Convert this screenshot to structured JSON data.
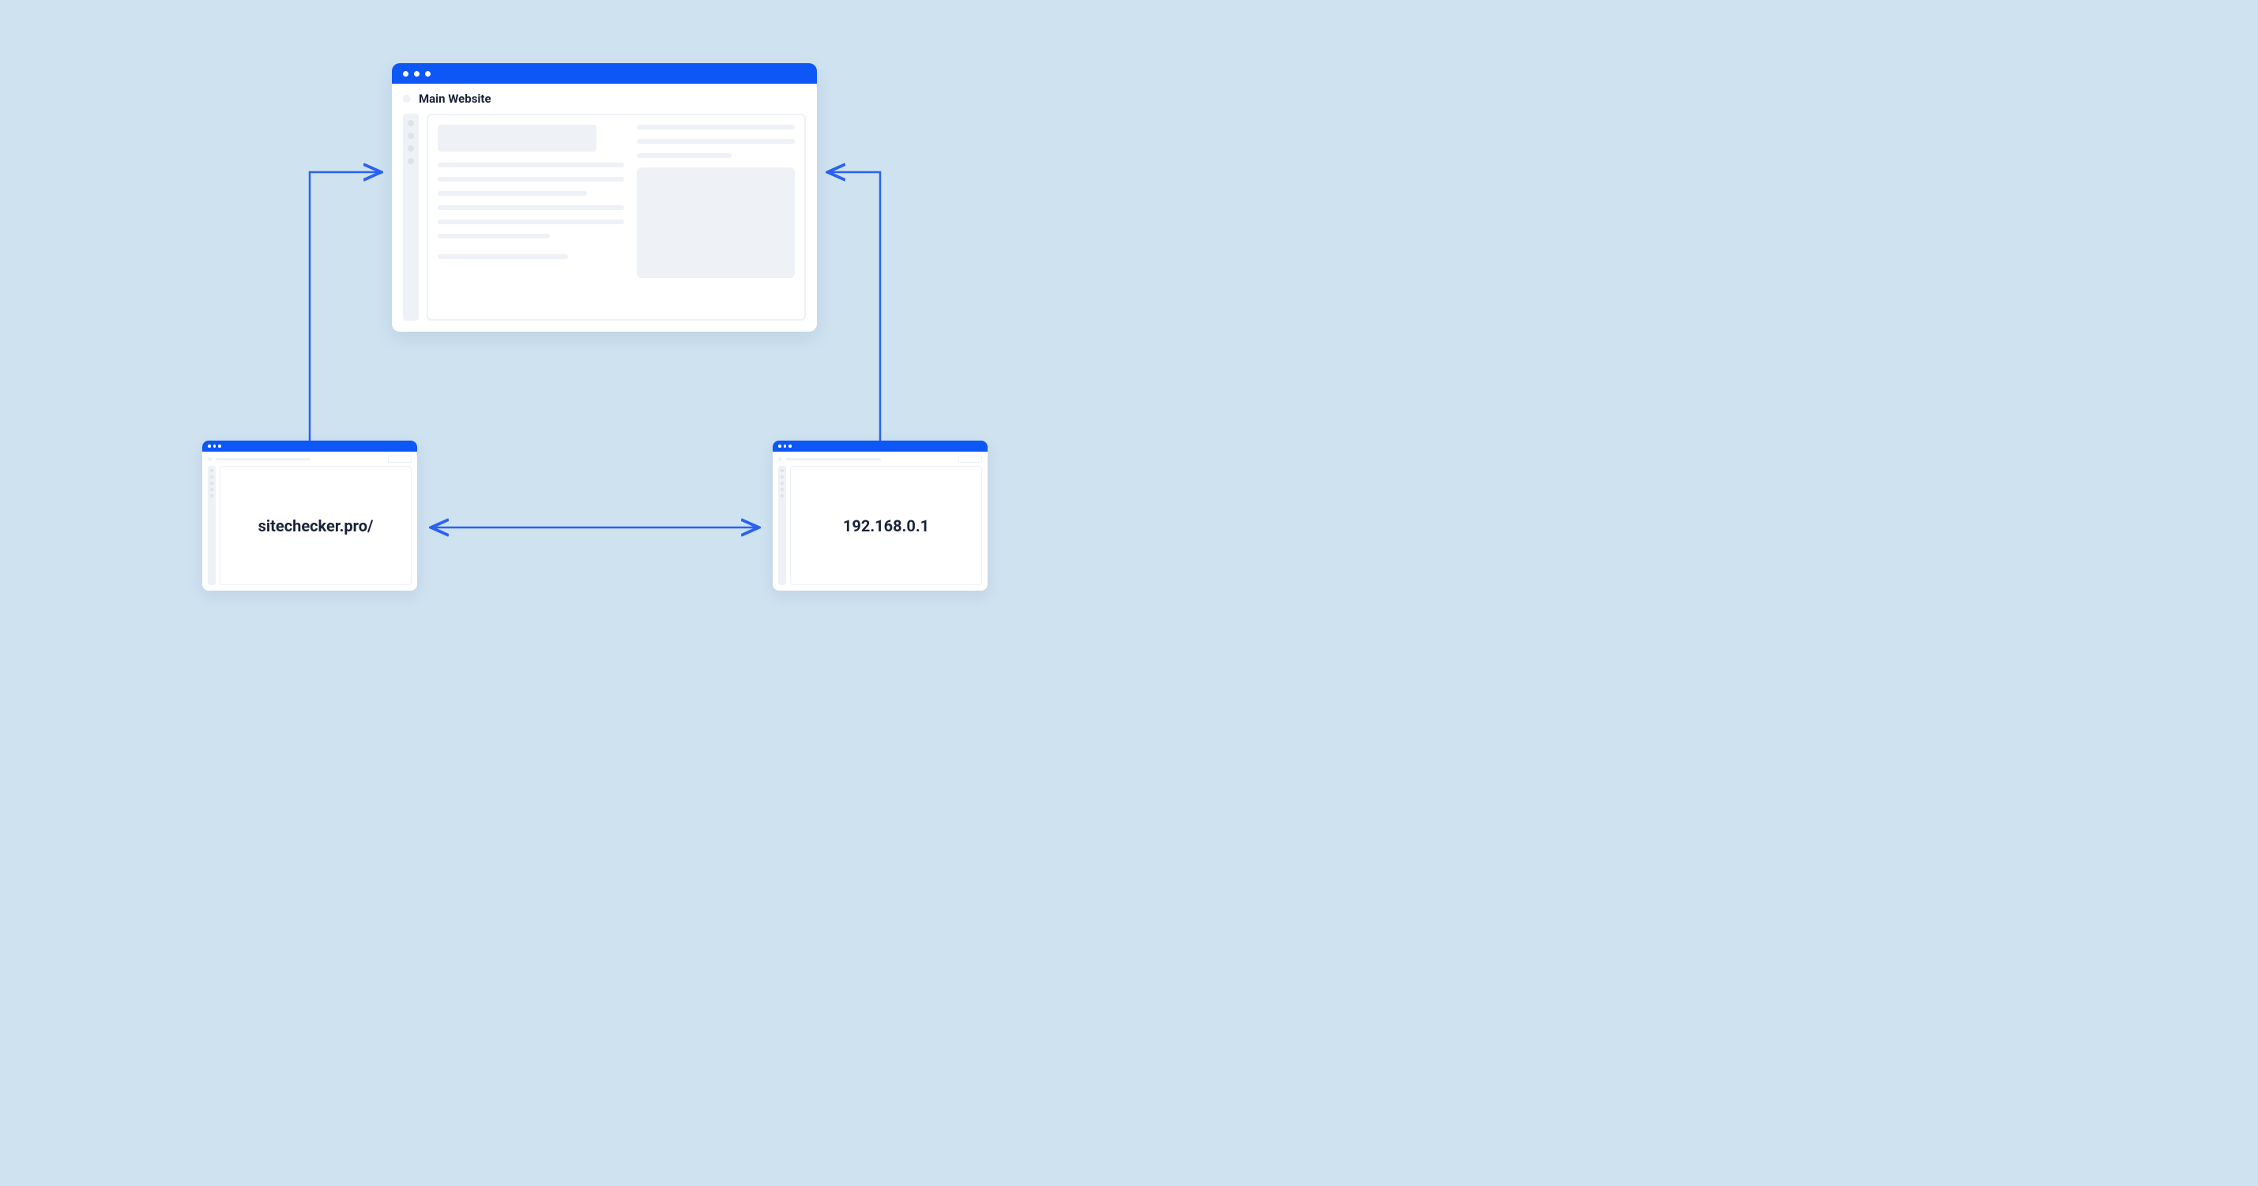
{
  "main_window": {
    "title": "Main Website"
  },
  "left_window": {
    "text": "sitechecker.pro/"
  },
  "right_window": {
    "text": "192.168.0.1"
  },
  "colors": {
    "background": "#cee2f0",
    "titlebar": "#0d57f7",
    "skeleton": "#eef1f5",
    "text": "#1a2339",
    "arrow": "#2a62f3"
  }
}
